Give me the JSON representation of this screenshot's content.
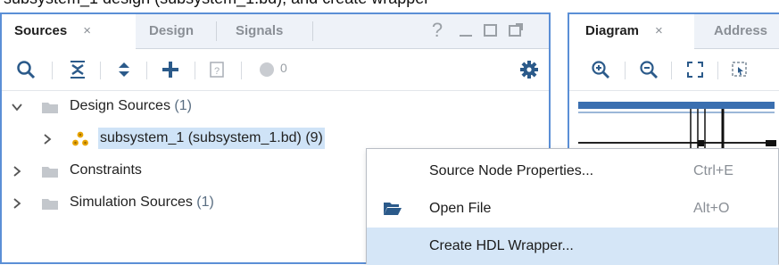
{
  "top_strip": {
    "text": "subsystem_1 design (subsystem_1.bd), and create wrapper"
  },
  "sources_panel": {
    "tabs": [
      {
        "label": "Sources",
        "close": "×"
      },
      {
        "label": "Design"
      },
      {
        "label": "Signals"
      }
    ],
    "window_buttons": {
      "help": "?",
      "minimize": "_",
      "maximize": "☐",
      "float": "⧉"
    },
    "toolbar": {
      "status_count": "0"
    },
    "tree": [
      {
        "label": "Design Sources",
        "count": "(1)",
        "expanded": true
      },
      {
        "label": "subsystem_1 (subsystem_1.bd) (9)",
        "expanded": false
      },
      {
        "label": "Constraints",
        "expanded": false
      },
      {
        "label": "Simulation Sources",
        "count": "(1)",
        "expanded": false
      }
    ]
  },
  "diagram_panel": {
    "tabs": [
      {
        "label": "Diagram",
        "close": "×"
      },
      {
        "label": "Address"
      }
    ]
  },
  "context_menu": {
    "items": [
      {
        "label": "Source Node Properties...",
        "shortcut": "Ctrl+E"
      },
      {
        "label": "Open File",
        "shortcut": "Alt+O",
        "icon": "folder-open-icon"
      },
      {
        "label": "Create HDL Wrapper...",
        "selected": true
      }
    ]
  },
  "colors": {
    "accent_border": "#5b8fd6",
    "selection": "#cfe3f7",
    "menu_selected": "#d5e6f7",
    "tab_bar": "#eef2f8",
    "bd_icon_orange": "#e8a400"
  }
}
